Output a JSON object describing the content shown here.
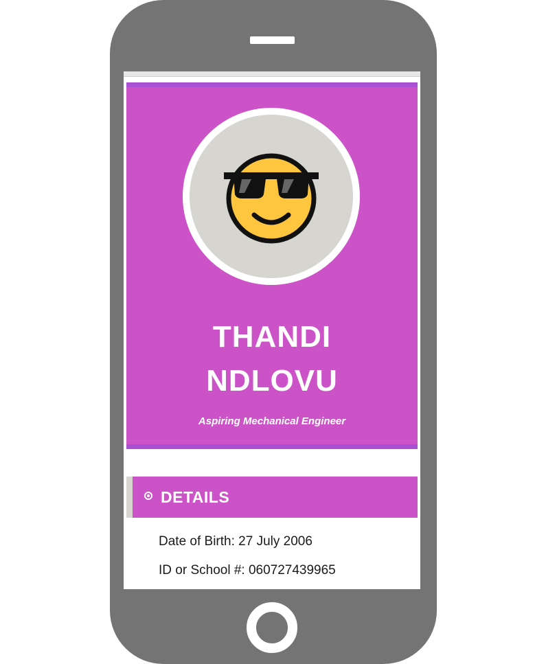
{
  "profile": {
    "first_name": "THANDI",
    "last_name": "NDLOVU",
    "tagline": "Aspiring Mechanical Engineer",
    "avatar_icon": "sunglasses-smiley-icon"
  },
  "details": {
    "heading": "DETAILS",
    "heading_icon": "circle-dot-icon",
    "dob_label": "Date of Birth: 27 July 2006",
    "id_label": "ID or School #: 060727439965"
  },
  "colors": {
    "accent": "#cc52c7",
    "accent_border": "#a84fd3",
    "phone_body": "#747474",
    "avatar_bg": "#d6d5cf"
  }
}
